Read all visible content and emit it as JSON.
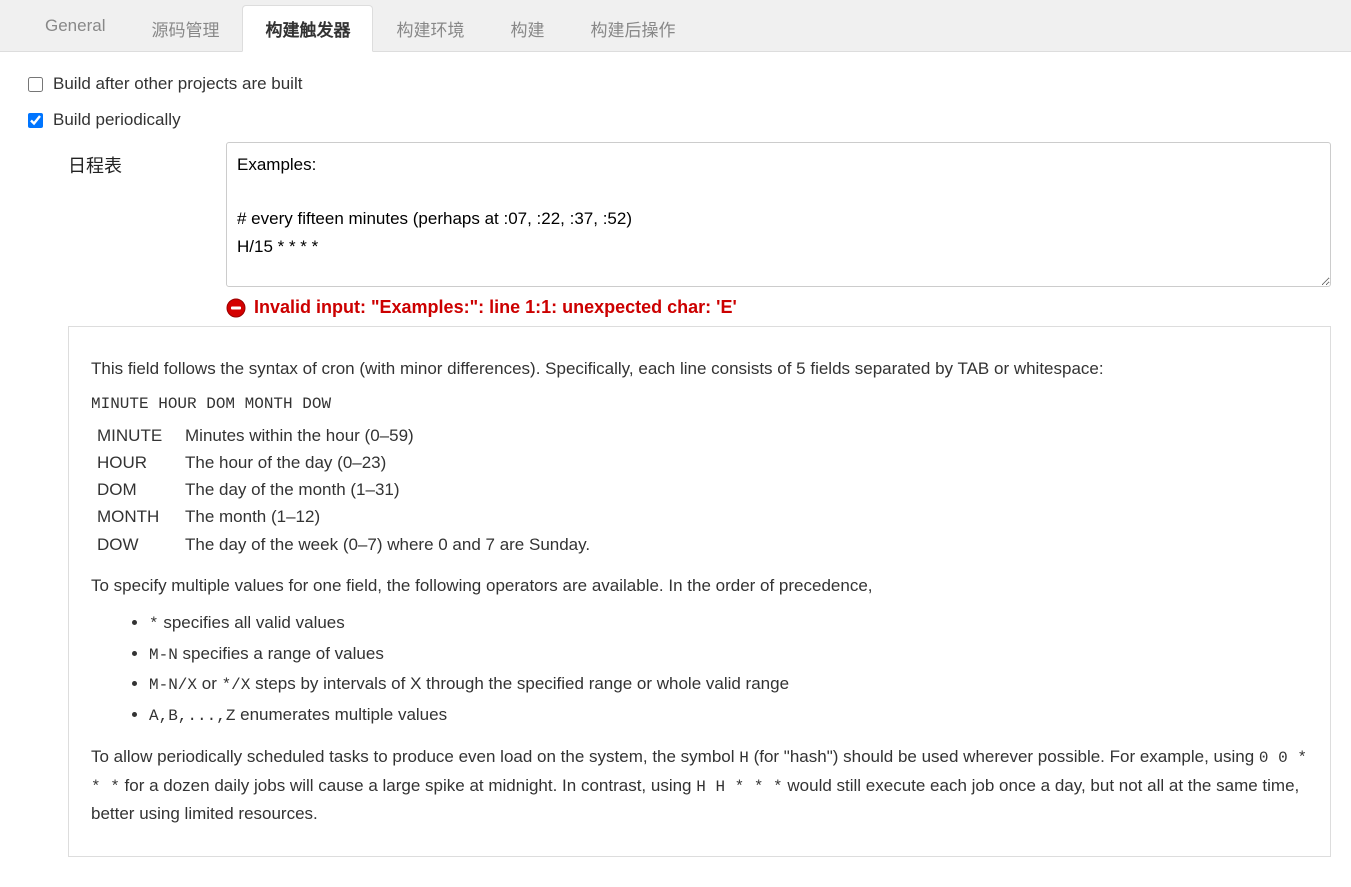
{
  "tabs": {
    "general": "General",
    "scm": "源码管理",
    "triggers": "构建触发器",
    "env": "构建环境",
    "build": "构建",
    "post": "构建后操作"
  },
  "triggers": {
    "buildAfter": {
      "label": "Build after other projects are built",
      "checked": false
    },
    "periodic": {
      "label": "Build periodically",
      "checked": true,
      "scheduleLabel": "日程表",
      "scheduleValue": "Examples:\n\n# every fifteen minutes (perhaps at :07, :22, :37, :52)\nH/15 * * * *",
      "error": "Invalid input: \"Examples:\": line 1:1: unexpected char: 'E'"
    }
  },
  "help": {
    "intro": "This field follows the syntax of cron (with minor differences). Specifically, each line consists of 5 fields separated by TAB or whitespace:",
    "syntax": "MINUTE HOUR DOM MONTH DOW",
    "defs": [
      {
        "term": "MINUTE",
        "desc": "Minutes within the hour (0–59)"
      },
      {
        "term": "HOUR",
        "desc": "The hour of the day (0–23)"
      },
      {
        "term": "DOM",
        "desc": "The day of the month (1–31)"
      },
      {
        "term": "MONTH",
        "desc": "The month (1–12)"
      },
      {
        "term": "DOW",
        "desc": "The day of the week (0–7) where 0 and 7 are Sunday."
      }
    ],
    "multi_intro": "To specify multiple values for one field, the following operators are available. In the order of precedence,",
    "ops": {
      "star_code": "*",
      "star_desc": " specifies all valid values",
      "mn_code": "M-N",
      "mn_desc": " specifies a range of values",
      "mnx_codeA": "M-N/X",
      "mnx_or": " or ",
      "mnx_codeB": "*/X",
      "mnx_desc": " steps by intervals of X through the specified range or whole valid range",
      "enum_code": "A,B,...,Z",
      "enum_desc": " enumerates multiple values"
    },
    "hash": {
      "p1": "To allow periodically scheduled tasks to produce even load on the system, the symbol ",
      "h1": "H",
      "p2": " (for \"hash\") should be used wherever possible. For example, using ",
      "c1": "0 0 * * *",
      "p3": " for a dozen daily jobs will cause a large spike at midnight. In contrast, using ",
      "c2": "H H * * *",
      "p4": " would still execute each job once a day, but not all at the same time, better using limited resources."
    }
  }
}
